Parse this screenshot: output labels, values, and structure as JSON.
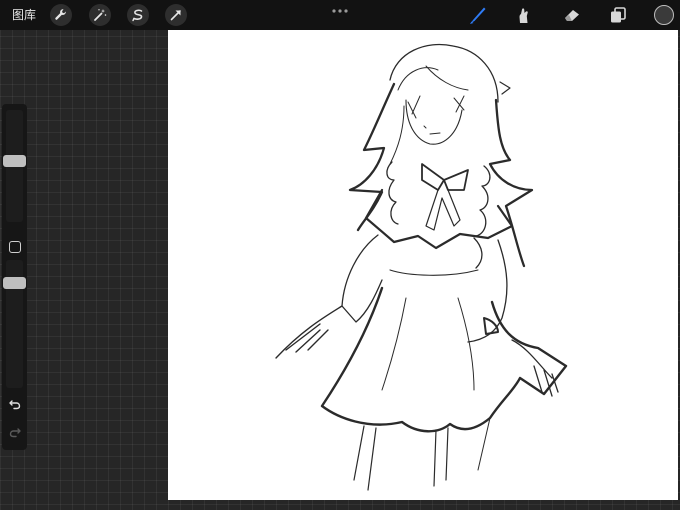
{
  "toolbar": {
    "gallery_label": "图库",
    "left_tools": [
      {
        "icon": "wrench-icon"
      },
      {
        "icon": "magic-wand-icon"
      },
      {
        "icon": "selection-icon"
      },
      {
        "icon": "transform-arrow-icon"
      }
    ],
    "right_tools": [
      {
        "icon": "brush-icon",
        "active": true
      },
      {
        "icon": "smudge-icon"
      },
      {
        "icon": "eraser-icon"
      },
      {
        "icon": "layers-icon"
      }
    ]
  },
  "colors": {
    "accent": "#2f7cf6",
    "current_color": "#3a3a3a",
    "canvas": "#ffffff"
  },
  "sidebar": {
    "brush_size_level": 0.55,
    "brush_opacity_level": 0.85
  }
}
